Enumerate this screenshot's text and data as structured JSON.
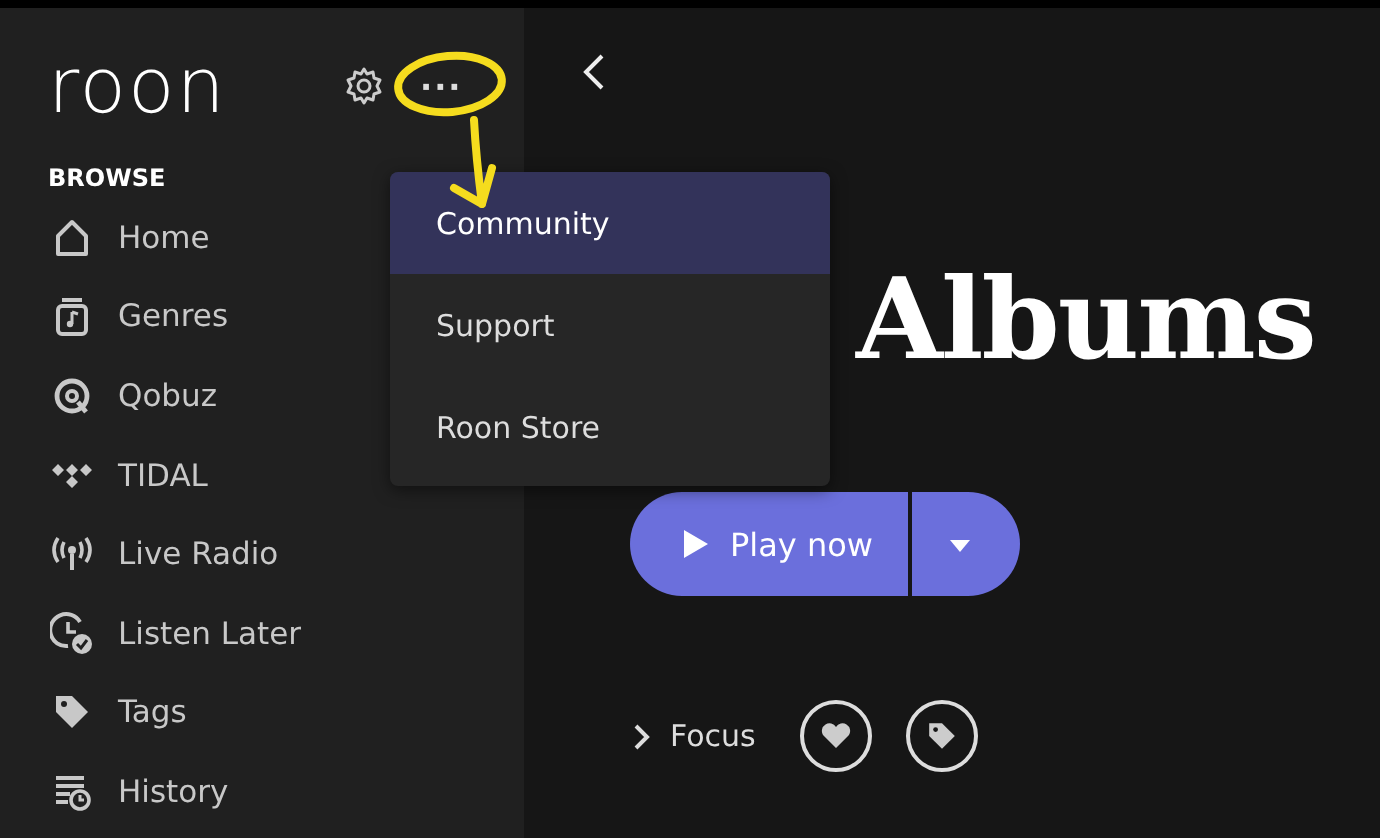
{
  "sidebar": {
    "logo": "roon",
    "more_button": "···",
    "section": "BROWSE",
    "items": [
      {
        "label": "Home"
      },
      {
        "label": "Genres"
      },
      {
        "label": "Qobuz"
      },
      {
        "label": "TIDAL"
      },
      {
        "label": "Live Radio"
      },
      {
        "label": "Listen Later"
      },
      {
        "label": "Tags"
      },
      {
        "label": "History"
      }
    ]
  },
  "menu": [
    {
      "label": "Community",
      "selected": true
    },
    {
      "label": "Support",
      "selected": false
    },
    {
      "label": "Roon Store",
      "selected": false
    }
  ],
  "main": {
    "title": "Albums",
    "play_button": "Play now",
    "focus": "Focus"
  }
}
